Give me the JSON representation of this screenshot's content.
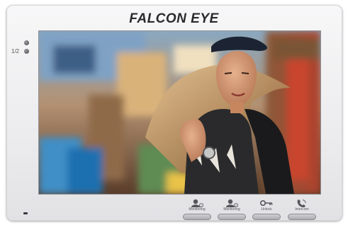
{
  "brand": {
    "name": "FALCON EYE"
  },
  "indicators": [
    {
      "label": "",
      "icon": "power-led"
    },
    {
      "label": "1/2",
      "icon": "channel-led"
    }
  ],
  "screen": {
    "content": "video-feed"
  },
  "controls": [
    {
      "label": "Monitoring",
      "badge": "1",
      "icon": "person-icon"
    },
    {
      "label": "Monitoring",
      "badge": "2",
      "icon": "person-icon"
    },
    {
      "label": "Unlock",
      "badge": "",
      "icon": "key-icon"
    },
    {
      "label": "Intercom",
      "badge": "",
      "icon": "handset-icon"
    }
  ],
  "colors": {
    "body": "#ececee",
    "brand_text": "#2a2a2e",
    "button": "#b8b8bd"
  }
}
